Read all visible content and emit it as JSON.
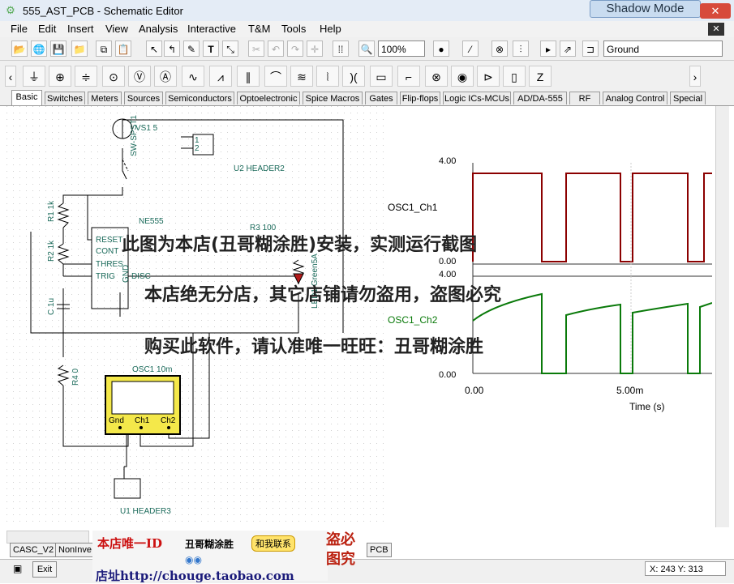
{
  "window": {
    "title": "555_AST_PCB - Schematic Editor",
    "shadow_mode": "Shadow Mode",
    "close": "✕"
  },
  "menu": [
    "File",
    "Edit",
    "Insert",
    "View",
    "Analysis",
    "Interactive",
    "T&M",
    "Tools",
    "Help"
  ],
  "toolbar": {
    "zoom": "100%",
    "ground": "Ground"
  },
  "component_tabs": [
    "Basic",
    "Switches",
    "Meters",
    "Sources",
    "Semiconductors",
    "Optoelectronic",
    "Spice Macros",
    "Gates",
    "Flip-flops",
    "Logic ICs-MCUs",
    "AD/DA-555",
    "RF",
    "Analog Control",
    "Special"
  ],
  "schematic": {
    "vs1": "VS1 5",
    "sw": "SW-SPST1",
    "u2": "U2 HEADER2",
    "r1": "R1 1k",
    "r2": "R2 1k",
    "ne555": "NE555",
    "reset": "RESET",
    "cont": "CONT",
    "thres": "THRES",
    "trig": "TRIG",
    "disc": "DISC",
    "gnd": "GND",
    "c1": "C 1u",
    "r3": "R3 100",
    "led": "LED1 Green5A",
    "r4": "R4 0",
    "osc": "OSC1 10m",
    "osc_gnd": "Gnd",
    "osc_ch1": "Ch1",
    "osc_ch2": "Ch2",
    "u1": "U1 HEADER3",
    "pin1": "1",
    "pin2": "2"
  },
  "chart_data": {
    "type": "line",
    "series": [
      {
        "name": "OSC1_Ch1",
        "ylim": [
          0,
          4.0
        ],
        "yticks": [
          "4.00",
          "0.00"
        ]
      },
      {
        "name": "OSC1_Ch2",
        "ylim": [
          0,
          4.0
        ],
        "yticks": [
          "4.00",
          "0.00"
        ]
      }
    ],
    "xlabel": "Time (s)",
    "xticks": [
      "0.00",
      "5.00m"
    ]
  },
  "overlay": {
    "line1": "此图为本店(丑哥糊涂胜)安装，实测运行截图",
    "line2": "本店绝无分店，其它店铺请勿盗用，盗图必究",
    "line3": "购买此软件，请认准唯一旺旺：丑哥糊涂胜",
    "id_label": "本店唯一ID",
    "shop_name": "丑哥糊涂胜",
    "contact": "和我联系",
    "address": "店址http://chouge.taobao.com",
    "steal": "盗必图究"
  },
  "bottom_tabs": [
    "CASC_V2",
    "NonInve",
    "PCB"
  ],
  "status": {
    "exit": "Exit",
    "coords": "X: 243  Y: 313"
  }
}
